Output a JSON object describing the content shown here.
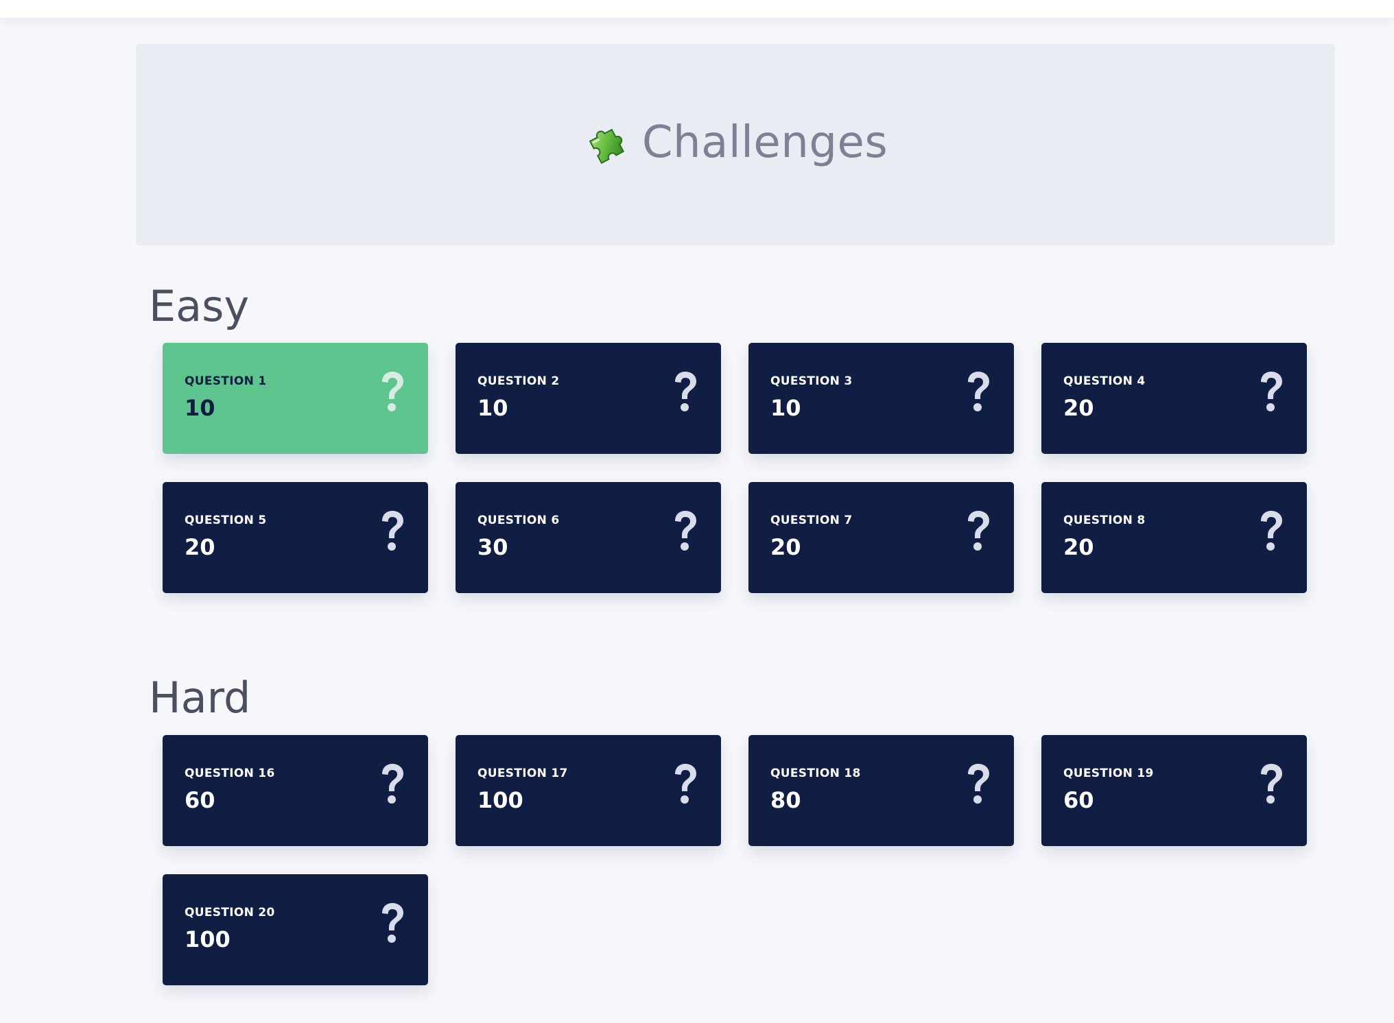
{
  "header": {
    "icon": "puzzle-piece-icon",
    "title": "Challenges"
  },
  "colors": {
    "page_background": "#f6f7fb",
    "hero_background": "#e9ecf3",
    "card_background": "#111e44",
    "card_solved_background": "#5fc58e",
    "question_icon": "#d9dcea",
    "solved_icon": "#d7ece1"
  },
  "sections": [
    {
      "title": "Easy",
      "cards": [
        {
          "label": "QUESTION 1",
          "points": "10",
          "solved": true,
          "icon": "question-mark-icon"
        },
        {
          "label": "QUESTION 2",
          "points": "10",
          "solved": false,
          "icon": "question-mark-icon"
        },
        {
          "label": "QUESTION 3",
          "points": "10",
          "solved": false,
          "icon": "question-mark-icon"
        },
        {
          "label": "QUESTION 4",
          "points": "20",
          "solved": false,
          "icon": "question-mark-icon"
        },
        {
          "label": "QUESTION 5",
          "points": "20",
          "solved": false,
          "icon": "question-mark-icon"
        },
        {
          "label": "QUESTION 6",
          "points": "30",
          "solved": false,
          "icon": "question-mark-icon"
        },
        {
          "label": "QUESTION 7",
          "points": "20",
          "solved": false,
          "icon": "question-mark-icon"
        },
        {
          "label": "QUESTION 8",
          "points": "20",
          "solved": false,
          "icon": "question-mark-icon"
        }
      ]
    },
    {
      "title": "Hard",
      "cards": [
        {
          "label": "QUESTION 16",
          "points": "60",
          "solved": false,
          "icon": "question-mark-icon"
        },
        {
          "label": "QUESTION 17",
          "points": "100",
          "solved": false,
          "icon": "question-mark-icon"
        },
        {
          "label": "QUESTION 18",
          "points": "80",
          "solved": false,
          "icon": "question-mark-icon"
        },
        {
          "label": "QUESTION 19",
          "points": "60",
          "solved": false,
          "icon": "question-mark-icon"
        },
        {
          "label": "QUESTION 20",
          "points": "100",
          "solved": false,
          "icon": "question-mark-icon"
        }
      ]
    }
  ]
}
